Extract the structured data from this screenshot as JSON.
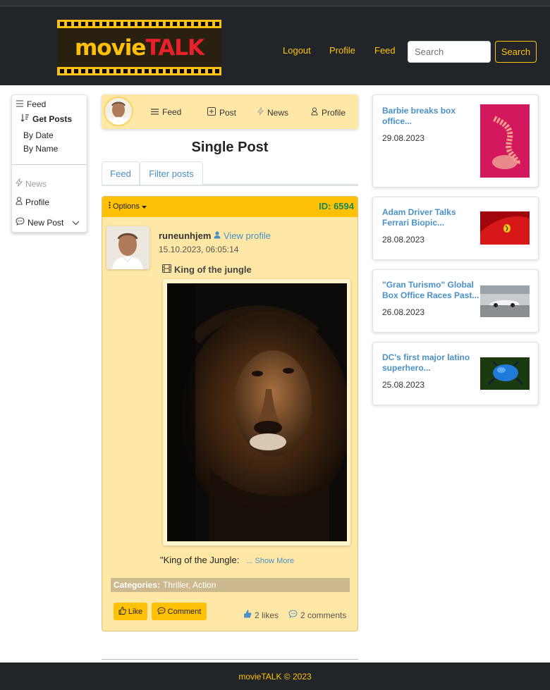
{
  "brand": {
    "logo_part1": "movie",
    "logo_part2": "TALK"
  },
  "nav": {
    "logout": "Logout",
    "profile": "Profile",
    "feed": "Feed"
  },
  "search": {
    "placeholder": "Search",
    "button": "Search"
  },
  "sidebar": {
    "feed": "Feed",
    "get_posts": "Get Posts",
    "by_date": "By Date",
    "by_name": "By Name",
    "news": "News",
    "profile": "Profile",
    "new_post": "New Post"
  },
  "subnav": {
    "feed": "Feed",
    "post": "Post",
    "news": "News",
    "profile": "Profile"
  },
  "page": {
    "title": "Single Post"
  },
  "tabs": [
    "Feed",
    "Filter posts"
  ],
  "post": {
    "options": "Options",
    "id": "ID: 6594",
    "username": "runeunhjem",
    "view_profile": "View profile",
    "timestamp": "15.10.2023, 06:05:14",
    "title": "King of the jungle",
    "excerpt": "\"King of the Jungle:",
    "show_more": "... Show More",
    "categories_label": "Categories:",
    "categories": "Thriller, Action",
    "like": "Like",
    "comment": "Comment",
    "likes": "2 likes",
    "comments": "2 comments"
  },
  "news": [
    {
      "title": "Barbie breaks box office...",
      "date": "29.08.2023"
    },
    {
      "title": "Adam Driver Talks Ferrari Biopic...",
      "date": "28.08.2023"
    },
    {
      "title": "\"Gran Turismo\" Global Box Office Races Past...",
      "date": "26.08.2023"
    },
    {
      "title": "DC's first major latino superhero...",
      "date": "25.08.2023"
    }
  ],
  "footer": {
    "text": "movieTALK © 2023"
  },
  "colors": {
    "brand_yellow": "#ffc107",
    "nav_dark": "#212529",
    "post_bg": "#ffe8a6",
    "link_blue": "#4a90c9",
    "id_green": "#198754"
  }
}
